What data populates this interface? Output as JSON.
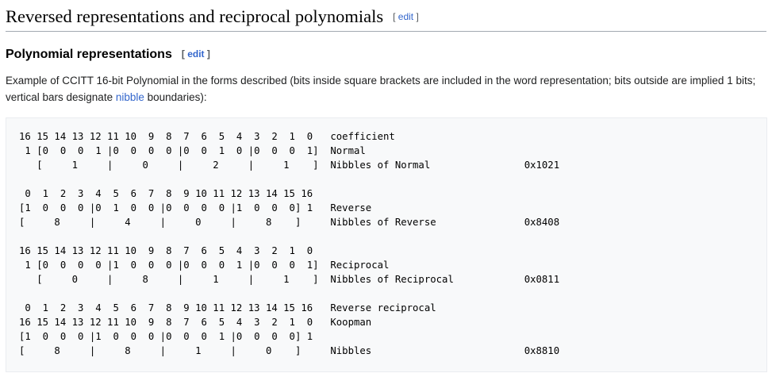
{
  "section": {
    "title": "Reversed representations and reciprocal polynomials",
    "edit_label": "edit"
  },
  "subsection": {
    "title": "Polynomial representations",
    "edit_label": "edit"
  },
  "paragraph": {
    "before_link": "Example of CCITT 16-bit Polynomial in the forms described (bits inside square brackets are included in the word representation; bits outside are implied 1 bits; vertical bars designate ",
    "link": "nibble",
    "after_link": " boundaries):"
  },
  "pre_lines": [
    "16 15 14 13 12 11 10  9  8  7  6  5  4  3  2  1  0   coefficient",
    " 1 [0  0  0  1 |0  0  0  0 |0  0  1  0 |0  0  0  1]  Normal",
    "   [     1     |     0     |     2     |     1    ]  Nibbles of Normal                0x1021",
    "",
    " 0  1  2  3  4  5  6  7  8  9 10 11 12 13 14 15 16",
    "[1  0  0  0 |0  1  0  0 |0  0  0  0 |1  0  0  0] 1   Reverse",
    "[     8     |     4     |     0     |     8    ]     Nibbles of Reverse               0x8408",
    "",
    "16 15 14 13 12 11 10  9  8  7  6  5  4  3  2  1  0",
    " 1 [0  0  0  0 |1  0  0  0 |0  0  0  1 |0  0  0  1]  Reciprocal",
    "   [     0     |     8     |     1     |     1    ]  Nibbles of Reciprocal            0x0811",
    "",
    " 0  1  2  3  4  5  6  7  8  9 10 11 12 13 14 15 16   Reverse reciprocal",
    "16 15 14 13 12 11 10  9  8  7  6  5  4  3  2  1  0   Koopman",
    "[1  0  0  0 |1  0  0  0 |0  0  0  1 |0  0  0  0] 1",
    "[     8     |     8     |     1     |     0    ]     Nibbles                          0x8810"
  ]
}
